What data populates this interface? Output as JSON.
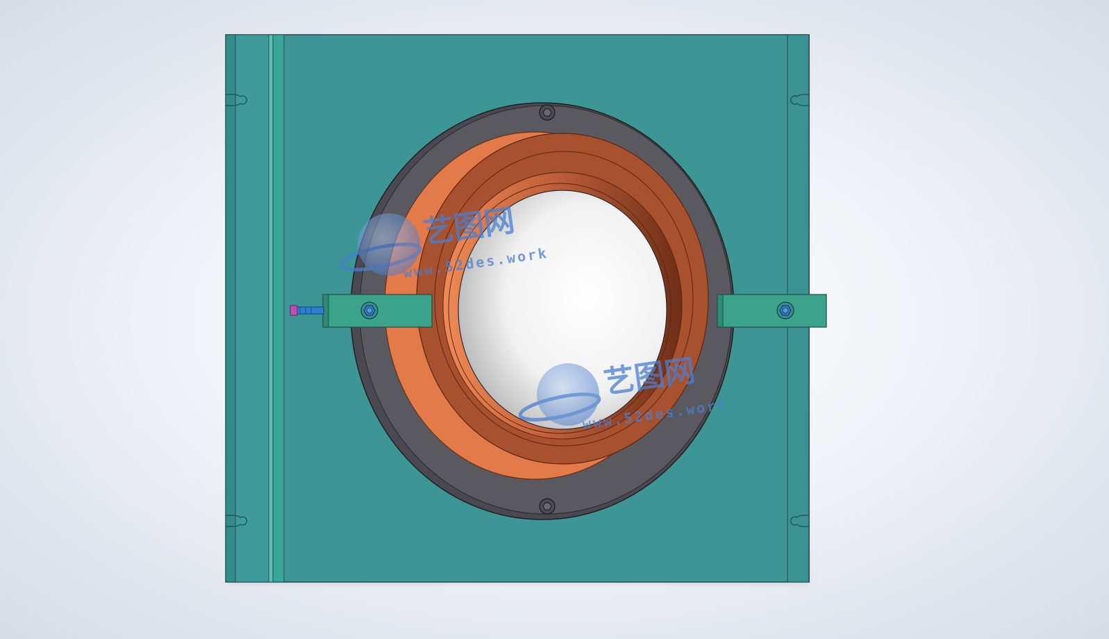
{
  "viewport": {
    "name": "cad-model-viewport"
  },
  "watermark": {
    "brand": "艺图网",
    "url": "www.52des.work"
  },
  "colors": {
    "background_center": "#ffffff",
    "background_edge": "#d6dce6",
    "plate": "#3d9595",
    "plate_edge": "#1f4f4f",
    "flange": "#5b5960",
    "ring_outer": "#e37a4a",
    "ring_face": "#a8512e",
    "ring_inner": "#8c3f22",
    "bracket": "#3aa38a",
    "bolt": "#2f7fd0",
    "screw_head": "#c04fb0",
    "watermark": "#4a7fd0"
  }
}
